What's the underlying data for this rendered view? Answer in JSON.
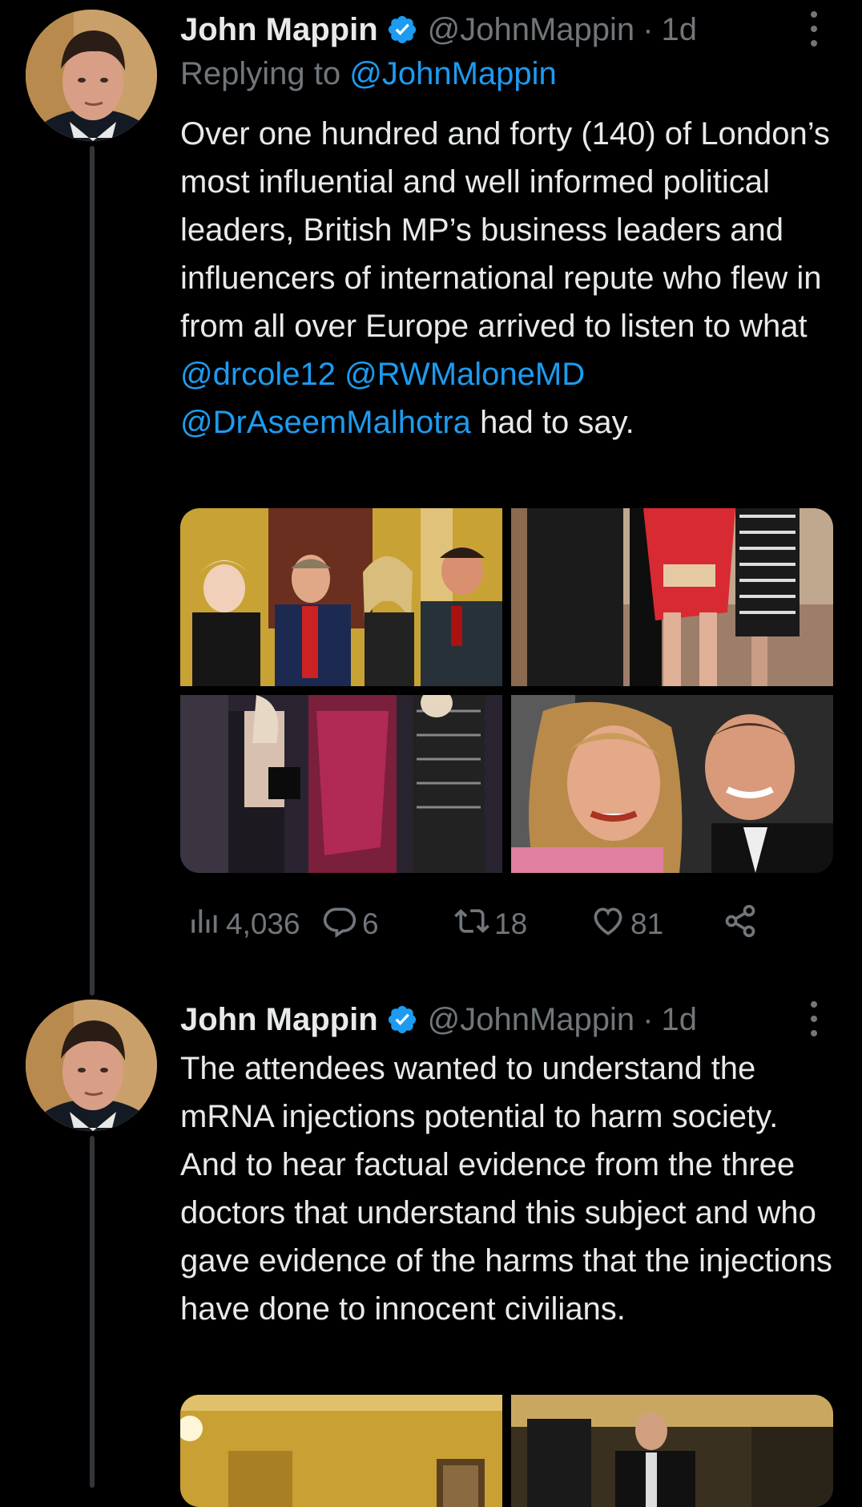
{
  "tweet1": {
    "name": "John Mappin",
    "handle": "@JohnMappin",
    "separator": "·",
    "time": "1d",
    "reply_prefix": "Replying to",
    "reply_handle": "@JohnMappin",
    "text_main": "Over one hundred and forty (140) of London’s most influential and well informed political leaders, British MP’s business leaders and influencers of international repute who flew in from all over Europe arrived to listen to what",
    "mention1": "@drcole12",
    "mention2": "@RWMaloneMD",
    "mention3": "@DrAseemMalhotra",
    "text_end": "had to say.",
    "stats": {
      "views": "4,036",
      "replies": "6",
      "retweets": "18",
      "likes": "81"
    }
  },
  "tweet2": {
    "name": "John Mappin",
    "handle": "@JohnMappin",
    "separator": "·",
    "time": "1d",
    "text": "The attendees wanted to understand the mRNA injections potential to harm society.   And to hear factual evidence from the three doctors that understand this subject and who gave evidence of the harms that the injections have done to innocent civilians."
  },
  "colors": {
    "background": "#000000",
    "text": "#e7e9ea",
    "secondary": "#71767b",
    "accent": "#1d9bf0"
  },
  "icons": [
    "verified-badge-icon",
    "more-icon",
    "views-icon",
    "reply-icon",
    "retweet-icon",
    "like-icon",
    "share-icon"
  ]
}
